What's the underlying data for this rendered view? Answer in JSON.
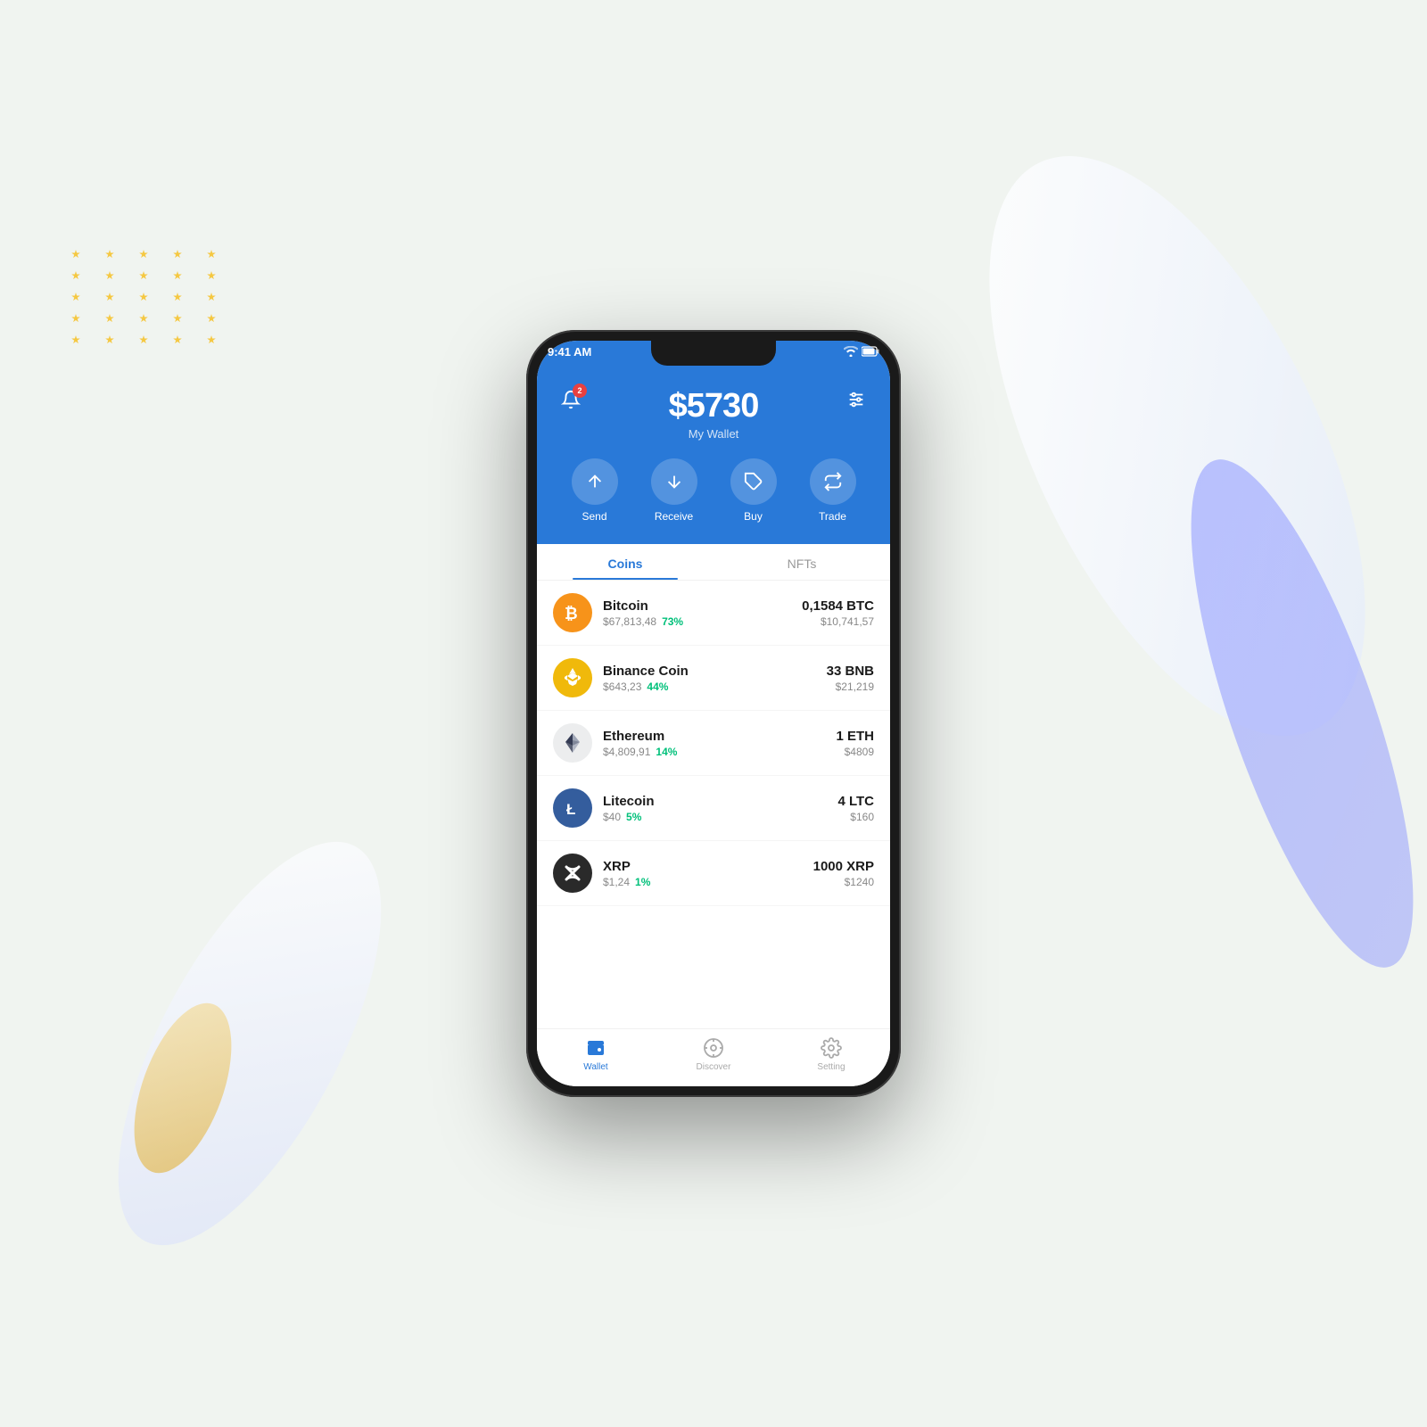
{
  "status_bar": {
    "time": "9:41 AM",
    "wifi": "wifi",
    "battery": "battery"
  },
  "header": {
    "balance": "$5730",
    "balance_label": "My Wallet",
    "notification_count": "2"
  },
  "actions": [
    {
      "label": "Send",
      "icon": "send"
    },
    {
      "label": "Receive",
      "icon": "receive"
    },
    {
      "label": "Buy",
      "icon": "buy"
    },
    {
      "label": "Trade",
      "icon": "trade"
    }
  ],
  "tabs": [
    {
      "label": "Coins",
      "active": true
    },
    {
      "label": "NFTs",
      "active": false
    }
  ],
  "coins": [
    {
      "name": "Bitcoin",
      "price": "$67,813,48",
      "change": "73%",
      "qty": "0,1584 BTC",
      "value": "$10,741,57",
      "symbol": "BTC",
      "logo_char": "₿",
      "logo_class": "btc-logo"
    },
    {
      "name": "Binance Coin",
      "price": "$643,23",
      "change": "44%",
      "qty": "33 BNB",
      "value": "$21,219",
      "symbol": "BNB",
      "logo_char": "◆",
      "logo_class": "bnb-logo"
    },
    {
      "name": "Ethereum",
      "price": "$4,809,91",
      "change": "14%",
      "qty": "1 ETH",
      "value": "$4809",
      "symbol": "ETH",
      "logo_char": "⬡",
      "logo_class": "eth-logo"
    },
    {
      "name": "Litecoin",
      "price": "$40",
      "change": "5%",
      "qty": "4 LTC",
      "value": "$160",
      "symbol": "LTC",
      "logo_char": "Ł",
      "logo_class": "ltc-logo"
    },
    {
      "name": "XRP",
      "price": "$1,24",
      "change": "1%",
      "qty": "1000 XRP",
      "value": "$1240",
      "symbol": "XRP",
      "logo_char": "✕",
      "logo_class": "xrp-logo"
    }
  ],
  "bottom_nav": [
    {
      "label": "Wallet",
      "active": true,
      "icon": "wallet-icon"
    },
    {
      "label": "Discover",
      "active": false,
      "icon": "discover-icon"
    },
    {
      "label": "Setting",
      "active": false,
      "icon": "setting-icon"
    }
  ]
}
